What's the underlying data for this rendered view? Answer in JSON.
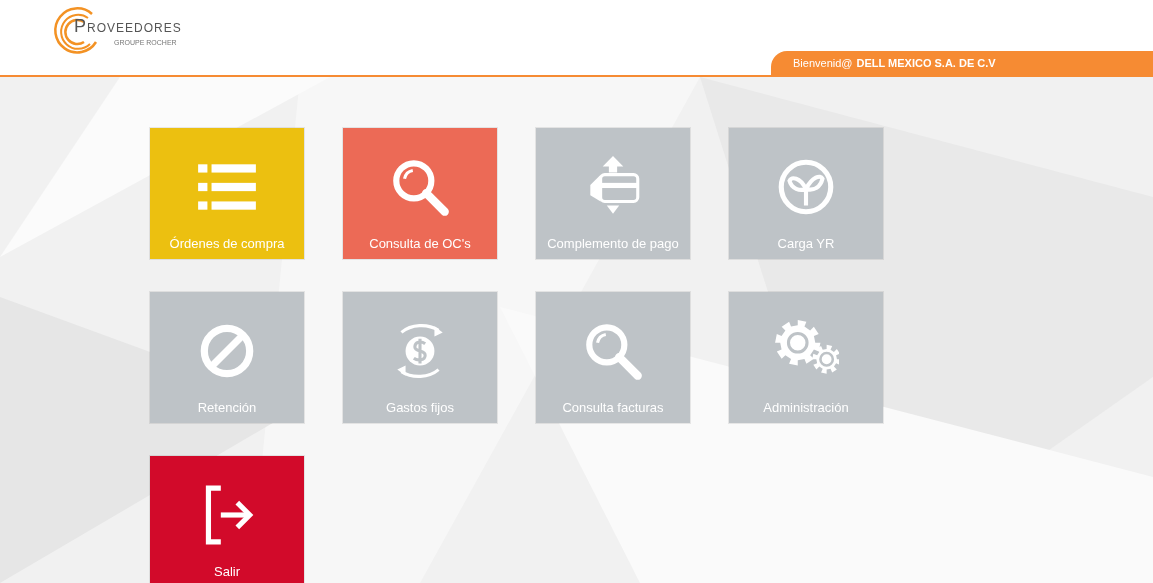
{
  "header": {
    "logo_title": "PROVEEDORES",
    "logo_subtitle": "GROUPE ROCHER",
    "welcome_prefix": "Bienvenid@",
    "company": "DELL MEXICO S.A. DE C.V"
  },
  "tiles": [
    {
      "label": "Órdenes de compra",
      "kind": "list",
      "color": "#ecc010"
    },
    {
      "label": "Consulta de OC's",
      "kind": "search",
      "color": "#ec6a56"
    },
    {
      "label": "Complemento de pago",
      "kind": "card",
      "color": "#bec3c7"
    },
    {
      "label": "Carga YR",
      "kind": "leaf",
      "color": "#bec3c7"
    },
    {
      "label": "Retención",
      "kind": "forbidden",
      "color": "#bec3c7"
    },
    {
      "label": "Gastos fijos",
      "kind": "money",
      "color": "#bec3c7"
    },
    {
      "label": "Consulta facturas",
      "kind": "search",
      "color": "#bec3c7"
    },
    {
      "label": "Administración",
      "kind": "gears",
      "color": "#bec3c7"
    },
    {
      "label": "Salir",
      "kind": "exit",
      "color": "#d20a2a"
    }
  ]
}
